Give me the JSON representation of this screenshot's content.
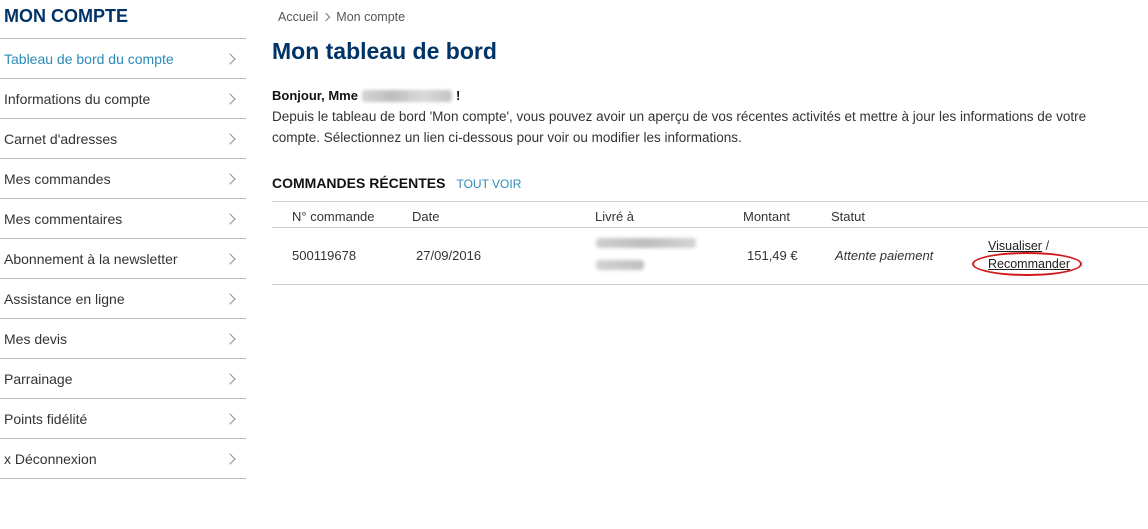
{
  "sidebar": {
    "title": "MON COMPTE",
    "items": [
      {
        "label": "Tableau de bord du compte"
      },
      {
        "label": "Informations du compte"
      },
      {
        "label": "Carnet d'adresses"
      },
      {
        "label": "Mes commandes"
      },
      {
        "label": "Mes commentaires"
      },
      {
        "label": "Abonnement à la newsletter"
      },
      {
        "label": "Assistance en ligne"
      },
      {
        "label": "Mes devis"
      },
      {
        "label": "Parrainage"
      },
      {
        "label": "Points fidélité"
      },
      {
        "label": "x Déconnexion"
      }
    ],
    "active_index": 0
  },
  "breadcrumb": {
    "home": "Accueil",
    "current": "Mon compte"
  },
  "main": {
    "title": "Mon tableau de bord",
    "greeting_prefix": "Bonjour, Mme",
    "greeting_suffix": "!",
    "intro": "Depuis le tableau de bord 'Mon compte', vous pouvez avoir un aperçu de vos récentes activités et mettre à jour les informations de votre compte. Sélectionnez un lien ci-dessous pour voir ou modifier les informations."
  },
  "orders": {
    "section_title": "COMMANDES RÉCENTES",
    "see_all": "TOUT VOIR",
    "columns": [
      "N° commande",
      "Date",
      "Livré à",
      "Montant",
      "Statut"
    ],
    "rows": [
      {
        "number": "500119678",
        "date": "27/09/2016",
        "amount": "151,49 €",
        "status": "Attente paiement",
        "view_label": "Visualiser",
        "separator": "/",
        "reorder_label": "Recommander"
      }
    ]
  },
  "colors": {
    "brand": "#003366",
    "link": "#2a8bb5",
    "highlight": "#d11a1a"
  }
}
